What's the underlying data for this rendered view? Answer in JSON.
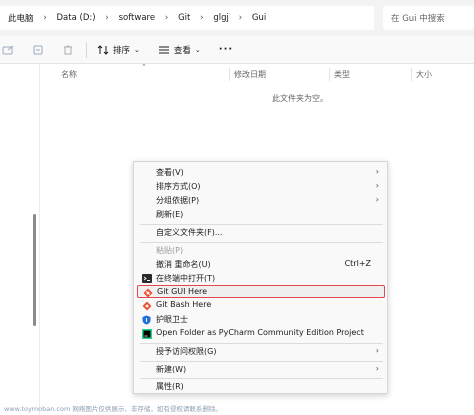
{
  "breadcrumb": {
    "items": [
      "此电脑",
      "Data (D:)",
      "software",
      "Git",
      "glgj",
      "Gui"
    ]
  },
  "search": {
    "placeholder": "在 Gui 中搜索"
  },
  "toolbar": {
    "sort_label": "排序",
    "view_label": "查看",
    "more_label": "···"
  },
  "columns": {
    "name": "名称",
    "modified": "修改日期",
    "type": "类型",
    "size": "大小"
  },
  "empty_text": "此文件夹为空。",
  "context_menu": {
    "view": "查看(V)",
    "sort_by": "排序方式(O)",
    "group_by": "分组依据(P)",
    "refresh": "刷新(E)",
    "customize": "自定义文件夹(F)...",
    "paste": "粘贴(P)",
    "undo": "撤消 重命名(U)",
    "undo_shortcut": "Ctrl+Z",
    "terminal": "在终端中打开(T)",
    "git_gui": "Git GUI Here",
    "git_bash": "Git Bash Here",
    "guard": "护眼卫士",
    "pycharm": "Open Folder as PyCharm Community Edition Project",
    "access": "授予访问权限(G)",
    "new": "新建(W)",
    "properties": "属性(R)"
  },
  "watermark": "www.toymoban.com 网络图片仅供展示，非存储，如有侵权请联系删除。",
  "colors": {
    "highlight_border": "#e0484b",
    "menu_bg": "#f9f9f9",
    "git_orange": "#f05133",
    "shield_blue": "#1e6fd9"
  }
}
